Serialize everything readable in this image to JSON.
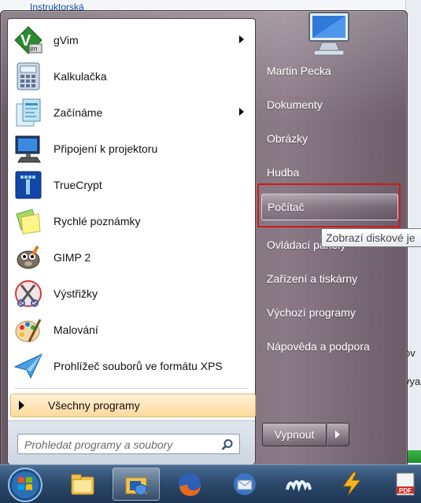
{
  "background": {
    "top_link": "Instruktorská",
    "snippet_lines": [
      "ov",
      "r vyaš"
    ]
  },
  "programs": [
    {
      "label": "gVim",
      "icon": "gvim-icon",
      "has_submenu": true
    },
    {
      "label": "Kalkulačka",
      "icon": "calculator-icon",
      "has_submenu": false
    },
    {
      "label": "Začínáme",
      "icon": "getting-started-icon",
      "has_submenu": true
    },
    {
      "label": "Připojení k projektoru",
      "icon": "projector-icon",
      "has_submenu": false
    },
    {
      "label": "TrueCrypt",
      "icon": "truecrypt-icon",
      "has_submenu": false
    },
    {
      "label": "Rychlé poznámky",
      "icon": "sticky-notes-icon",
      "has_submenu": false
    },
    {
      "label": "GIMP 2",
      "icon": "gimp-icon",
      "has_submenu": false
    },
    {
      "label": "Výstřižky",
      "icon": "snipping-tool-icon",
      "has_submenu": false
    },
    {
      "label": "Malování",
      "icon": "paint-icon",
      "has_submenu": false
    },
    {
      "label": "Prohlížeč souborů ve formátu XPS",
      "icon": "xps-viewer-icon",
      "has_submenu": false
    }
  ],
  "all_programs": "Všechny programy",
  "search": {
    "placeholder": "Prohledat programy a soubory"
  },
  "right_items": [
    {
      "label": "Martin Pecka",
      "highlighted": false
    },
    {
      "label": "Dokumenty",
      "highlighted": false
    },
    {
      "label": "Obrázky",
      "highlighted": false
    },
    {
      "label": "Hudba",
      "highlighted": false
    },
    {
      "label": "Počítač",
      "highlighted": true
    },
    {
      "label": "Ovládací panely",
      "highlighted": false
    },
    {
      "label": "Zařízení a tiskárny",
      "highlighted": false
    },
    {
      "label": "Výchozí programy",
      "highlighted": false
    },
    {
      "label": "Nápověda a podpora",
      "highlighted": false
    }
  ],
  "tooltip": "Zobrazí diskové je",
  "shutdown": {
    "label": "Vypnout"
  },
  "taskbar": {
    "items": [
      "start-orb",
      "file-explorer-icon",
      "control-panel-icon",
      "firefox-icon",
      "thunderbird-icon",
      "miranda-icon",
      "winamp-icon",
      "pdf-icon"
    ]
  },
  "colors": {
    "highlight_outline": "#d21919",
    "all_programs_bg": "#ffd99b",
    "taskbar": "#2c4a6c"
  }
}
